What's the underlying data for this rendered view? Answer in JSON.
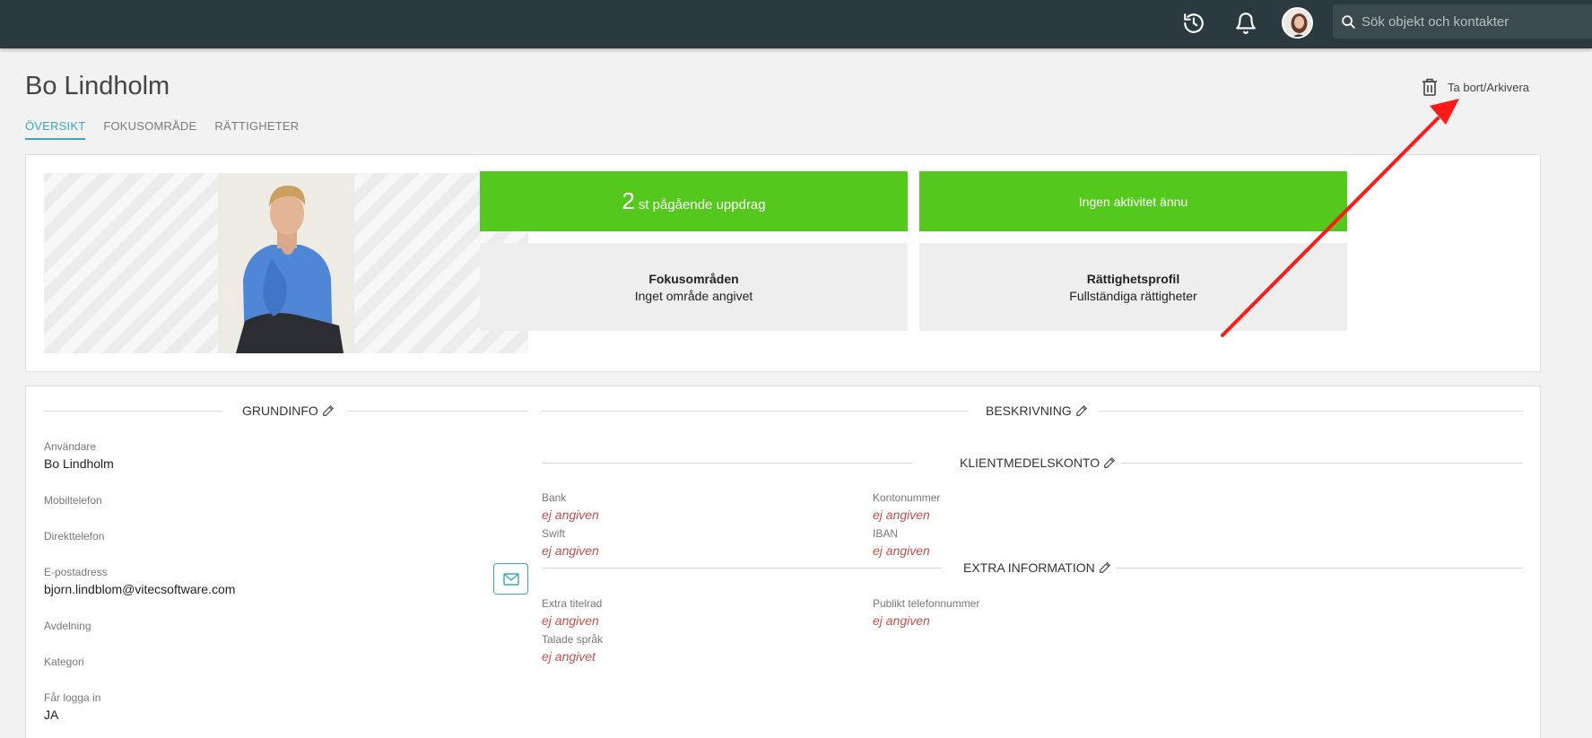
{
  "topbar": {
    "icons": [
      "history-icon",
      "bell-icon",
      "user-avatar",
      "search-icon"
    ],
    "search_placeholder": "Sök objekt och kontakter"
  },
  "header": {
    "title": "Bo Lindholm",
    "archive_label": "Ta bort/Arkivera"
  },
  "tabs": [
    {
      "label": "ÖVERSIKT",
      "active": true
    },
    {
      "label": "FOKUSOMRÅDE",
      "active": false
    },
    {
      "label": "RÄTTIGHETER",
      "active": false
    }
  ],
  "tiles": {
    "assignments_count": "2",
    "assignments_text": "st pågående uppdrag",
    "activity_text": "Ingen aktivitet ännu",
    "focus_title": "Fokusområden",
    "focus_value": "Inget område angivet",
    "rights_title": "Rättighetsprofil",
    "rights_value": "Fullständiga rättigheter"
  },
  "grundinfo": {
    "title": "GRUNDINFO",
    "user_label": "Användare",
    "user_value": "Bo Lindholm",
    "mobile_label": "Mobiltelefon",
    "direct_label": "Direkttelefon",
    "email_label": "E-postadress",
    "email_value": "bjorn.lindblom@vitecsoftware.com",
    "department_label": "Avdelning",
    "category_label": "Kategori",
    "login_label": "Får logga in",
    "login_value": "JA"
  },
  "beskrivning": {
    "title": "BESKRIVNING"
  },
  "klientmedel": {
    "title": "KLIENTMEDELSKONTO",
    "bank_label": "Bank",
    "bank_value": "ej angiven",
    "account_label": "Kontonummer",
    "account_value": "ej angiven",
    "swift_label": "Swift",
    "swift_value": "ej angiven",
    "iban_label": "IBAN",
    "iban_value": "ej angiven"
  },
  "extra": {
    "title": "EXTRA INFORMATION",
    "titleline_label": "Extra titelrad",
    "titleline_value": "ej angiven",
    "phone_label": "Publikt telefonnummer",
    "phone_value": "ej angiven",
    "language_label": "Talade språk",
    "language_value": "ej angivet"
  },
  "colors": {
    "topbar": "#2b3a3e",
    "accent": "#3aa7bd",
    "green": "#55c81e",
    "empty_value": "#c0504d",
    "arrow": "#ff1a1a"
  }
}
